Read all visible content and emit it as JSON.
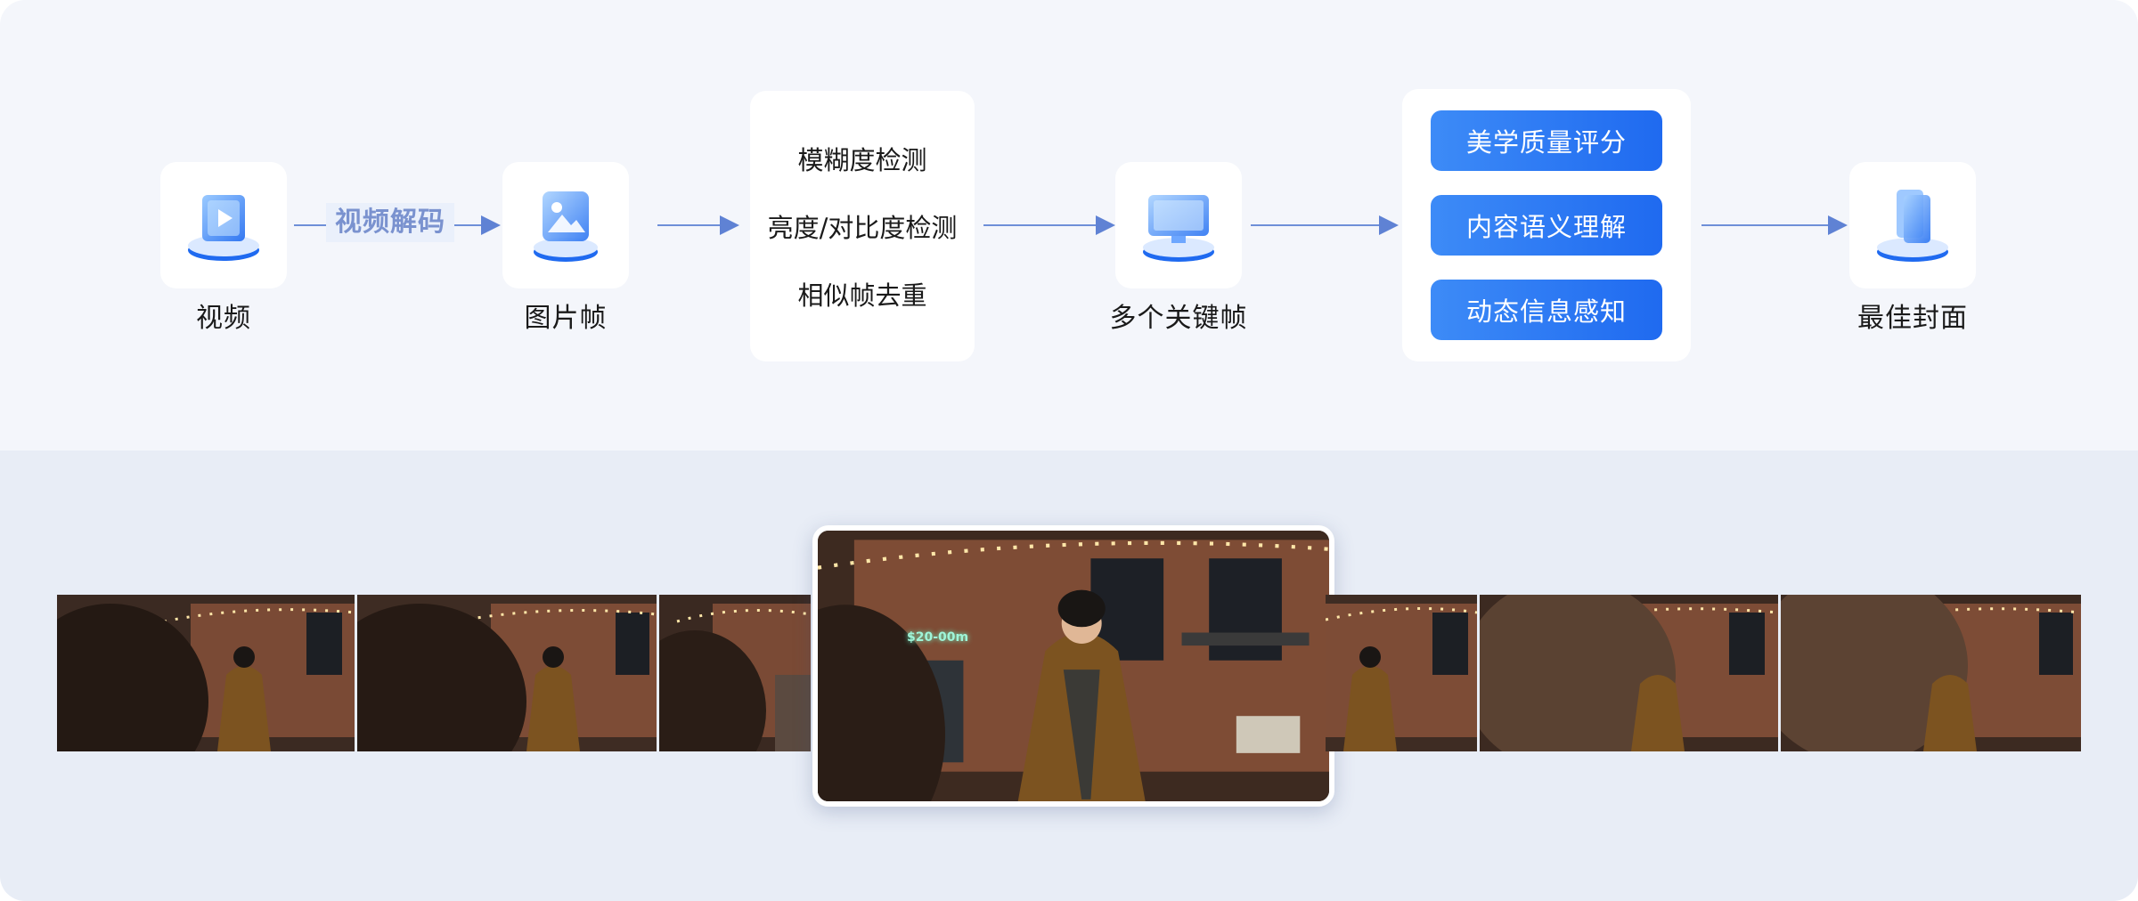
{
  "pipeline": {
    "video": "视频",
    "decode": "视频解码",
    "frames": "图片帧",
    "filters": [
      "模糊度检测",
      "亮度/对比度检测",
      "相似帧去重"
    ],
    "keyframes": "多个关键帧",
    "evaluations": [
      "美学质量评分",
      "内容语义理解",
      "动态信息感知"
    ],
    "cover": "最佳封面"
  },
  "storefront_sign": "$20-00m",
  "colors": {
    "accent": "#1f6af0",
    "arrow": "#6e8fd8",
    "top_bg": "#f4f6fb",
    "bottom_bg": "#e8edf6"
  },
  "icons": [
    "video-play-icon",
    "image-frame-icon",
    "screen-frame-icon",
    "stacked-layers-icon"
  ]
}
